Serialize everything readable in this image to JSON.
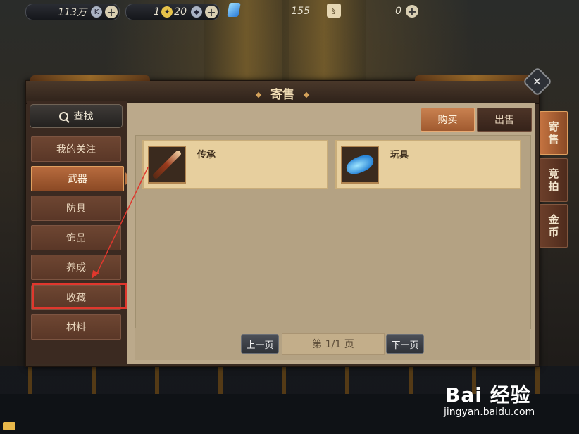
{
  "topbar": {
    "gold": {
      "value": "113万",
      "icon": "k-coin-icon"
    },
    "tickets": {
      "value": "1",
      "value2": "20",
      "icon": "ticket-icon"
    },
    "diamonds": {
      "value": "155",
      "icon": "diamond-icon"
    },
    "scrolls": {
      "value": "0",
      "icon": "scroll-icon"
    }
  },
  "panel": {
    "title": "寄售"
  },
  "search": {
    "label": "查找"
  },
  "categories": [
    "我的关注",
    "武器",
    "防具",
    "饰品",
    "养成",
    "收藏",
    "材料"
  ],
  "active_category": "武器",
  "actions": {
    "buy": "购买",
    "sell": "出售"
  },
  "items": [
    {
      "name": "传承",
      "icon": "sword-icon"
    },
    {
      "name": "玩具",
      "icon": "shark-toy-icon"
    }
  ],
  "pager": {
    "prev": "上一页",
    "info": "第 1/1 页",
    "next": "下一页"
  },
  "right_tabs": [
    {
      "label": "寄售",
      "active": true
    },
    {
      "label": "竞拍",
      "active": false
    },
    {
      "label": "金币",
      "active": false
    }
  ],
  "watermark": {
    "brand": "Bai 经验",
    "url": "jingyan.baidu.com"
  },
  "colors": {
    "accent": "#c98150",
    "highlight": "#e0372d",
    "panel": "#bba98b"
  }
}
